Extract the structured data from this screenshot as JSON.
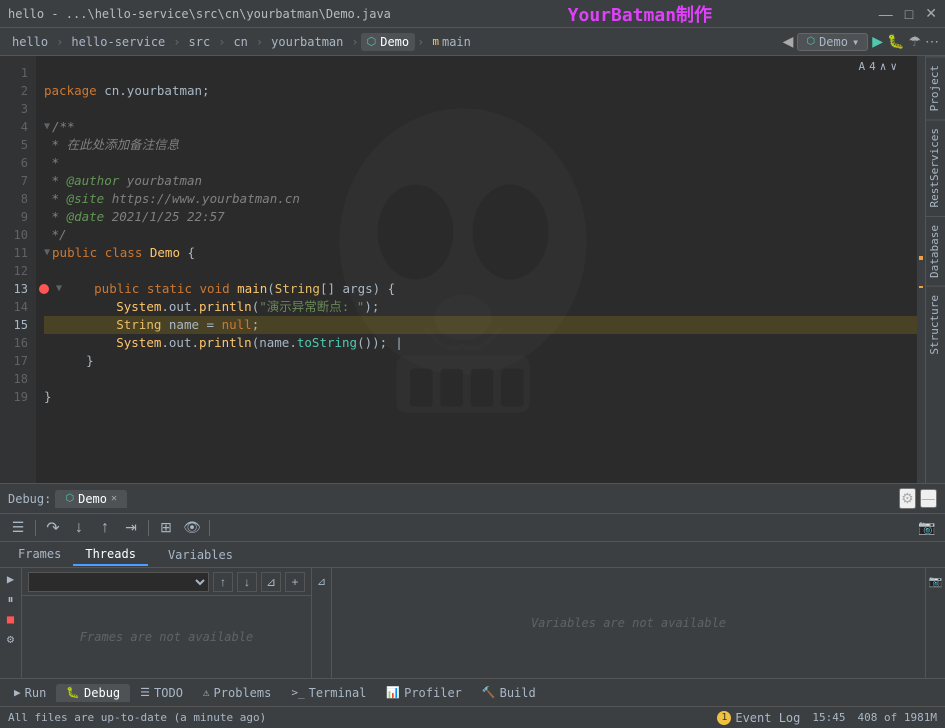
{
  "titleBar": {
    "title": "hello - ...\\hello-service\\src\\cn\\yourbatman\\Demo.java",
    "brand": "YourBatman制作",
    "windowControls": [
      "—",
      "□",
      "✕"
    ]
  },
  "navBar": {
    "breadcrumbs": [
      "hello",
      "hello-service",
      "src",
      "cn",
      "yourbatman"
    ],
    "fileTab": "Demo",
    "mainLabel": "main",
    "runConfig": "Demo",
    "backBtn": "◀",
    "forwardBtn": "▶"
  },
  "editor": {
    "lines": [
      {
        "num": 1,
        "code": "",
        "indent": 0
      },
      {
        "num": 2,
        "code": "package cn.yourbatman;",
        "indent": 0
      },
      {
        "num": 3,
        "code": "",
        "indent": 0
      },
      {
        "num": 4,
        "code": "/**",
        "indent": 0
      },
      {
        "num": 5,
        "code": " * 在此处添加备注信息",
        "indent": 1
      },
      {
        "num": 6,
        "code": " *",
        "indent": 1
      },
      {
        "num": 7,
        "code": " * @author yourbatman",
        "indent": 1
      },
      {
        "num": 8,
        "code": " * @site https://www.yourbatman.cn",
        "indent": 1
      },
      {
        "num": 9,
        "code": " * @date 2021/1/25 22:57",
        "indent": 1
      },
      {
        "num": 10,
        "code": " */",
        "indent": 1
      },
      {
        "num": 11,
        "code": "public class Demo {",
        "indent": 0
      },
      {
        "num": 12,
        "code": "",
        "indent": 0
      },
      {
        "num": 13,
        "code": "    public static void main(String[] args) {",
        "indent": 1
      },
      {
        "num": 14,
        "code": "        System.out.println(\"演示异常断点: \");",
        "indent": 2
      },
      {
        "num": 15,
        "code": "        String name = null;",
        "indent": 2
      },
      {
        "num": 16,
        "code": "        System.out.println(name.toString());",
        "indent": 2
      },
      {
        "num": 17,
        "code": "    }",
        "indent": 1
      },
      {
        "num": 18,
        "code": "",
        "indent": 0
      },
      {
        "num": 19,
        "code": "}",
        "indent": 0
      }
    ],
    "cursorLine": 15
  },
  "rightSidebar": {
    "tabs": [
      "Project",
      "RestServices",
      "Database",
      "Structure"
    ]
  },
  "debugPanel": {
    "title": "Debug:",
    "activeTab": "Demo",
    "settings": "⚙",
    "minimize": "—",
    "toolbar": {
      "buttons": [
        "≡",
        "↩",
        "↘",
        "↗",
        "↑",
        "⬛",
        "▶",
        "⏸",
        "☝",
        "⊞"
      ]
    },
    "subtabs": {
      "frames": "Frames",
      "threads": "Threads"
    },
    "variablesLabel": "Variables",
    "framesEmpty": "Frames are not available",
    "variablesEmpty": "Variables are not available",
    "framesToolbar": {
      "upBtn": "↑",
      "downBtn": "↓",
      "filterBtn": "⊿",
      "addBtn": "+"
    }
  },
  "bottomTabs": [
    {
      "label": "Run",
      "icon": "▶",
      "active": false
    },
    {
      "label": "Debug",
      "icon": "🐛",
      "active": true
    },
    {
      "label": "TODO",
      "icon": "☰",
      "active": false
    },
    {
      "label": "Problems",
      "icon": "⚠",
      "active": false
    },
    {
      "label": "Terminal",
      "icon": ">_",
      "active": false
    },
    {
      "label": "Profiler",
      "icon": "📊",
      "active": false
    },
    {
      "label": "Build",
      "icon": "🔨",
      "active": false
    }
  ],
  "statusBar": {
    "message": "All files are up-to-date (a minute ago)",
    "time": "15:45",
    "memory": "408 of 1981M",
    "eventLog": "Event Log",
    "eventCount": "1"
  }
}
